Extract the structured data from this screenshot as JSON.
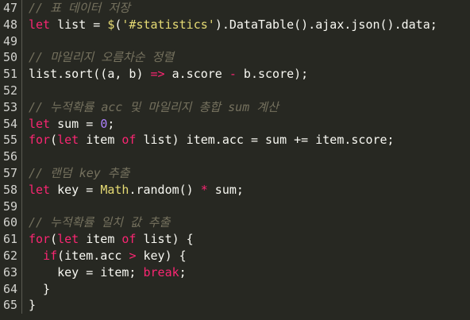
{
  "editor": {
    "lines": [
      {
        "number": "47",
        "tokens": [
          {
            "type": "comment",
            "text": "// 표 데이터 저장"
          }
        ]
      },
      {
        "number": "48",
        "tokens": [
          {
            "type": "keyword",
            "text": "let"
          },
          {
            "type": "plain",
            "text": " list = "
          },
          {
            "type": "func",
            "text": "$"
          },
          {
            "type": "plain",
            "text": "("
          },
          {
            "type": "string",
            "text": "'#statistics'"
          },
          {
            "type": "plain",
            "text": ").DataTable().ajax.json().data;"
          }
        ]
      },
      {
        "number": "49",
        "tokens": []
      },
      {
        "number": "50",
        "tokens": [
          {
            "type": "comment",
            "text": "// 마일리지 오름차순 정렬"
          }
        ]
      },
      {
        "number": "51",
        "tokens": [
          {
            "type": "plain",
            "text": "list.sort((a, b) "
          },
          {
            "type": "keyword",
            "text": "=>"
          },
          {
            "type": "plain",
            "text": " a.score "
          },
          {
            "type": "keyword",
            "text": "-"
          },
          {
            "type": "plain",
            "text": " b.score);"
          }
        ]
      },
      {
        "number": "52",
        "tokens": []
      },
      {
        "number": "53",
        "tokens": [
          {
            "type": "comment",
            "text": "// 누적확률 acc 및 마일리지 총합 sum 계산"
          }
        ]
      },
      {
        "number": "54",
        "tokens": [
          {
            "type": "keyword",
            "text": "let"
          },
          {
            "type": "plain",
            "text": " sum = "
          },
          {
            "type": "number",
            "text": "0"
          },
          {
            "type": "plain",
            "text": ";"
          }
        ]
      },
      {
        "number": "55",
        "tokens": [
          {
            "type": "keyword",
            "text": "for"
          },
          {
            "type": "plain",
            "text": "("
          },
          {
            "type": "keyword",
            "text": "let"
          },
          {
            "type": "plain",
            "text": " item "
          },
          {
            "type": "keyword",
            "text": "of"
          },
          {
            "type": "plain",
            "text": " list) item.acc = sum += item.score;"
          }
        ]
      },
      {
        "number": "56",
        "tokens": []
      },
      {
        "number": "57",
        "tokens": [
          {
            "type": "comment",
            "text": "// 랜덤 key 추출"
          }
        ]
      },
      {
        "number": "58",
        "tokens": [
          {
            "type": "keyword",
            "text": "let"
          },
          {
            "type": "plain",
            "text": " key = "
          },
          {
            "type": "func",
            "text": "Math"
          },
          {
            "type": "plain",
            "text": ".random() "
          },
          {
            "type": "keyword",
            "text": "*"
          },
          {
            "type": "plain",
            "text": " sum;"
          }
        ]
      },
      {
        "number": "59",
        "tokens": []
      },
      {
        "number": "60",
        "tokens": [
          {
            "type": "comment",
            "text": "// 누적확률 일치 값 추출"
          }
        ]
      },
      {
        "number": "61",
        "tokens": [
          {
            "type": "keyword",
            "text": "for"
          },
          {
            "type": "plain",
            "text": "("
          },
          {
            "type": "keyword",
            "text": "let"
          },
          {
            "type": "plain",
            "text": " item "
          },
          {
            "type": "keyword",
            "text": "of"
          },
          {
            "type": "plain",
            "text": " list) {"
          }
        ]
      },
      {
        "number": "62",
        "tokens": [
          {
            "type": "plain",
            "text": "  "
          },
          {
            "type": "keyword",
            "text": "if"
          },
          {
            "type": "plain",
            "text": "(item.acc "
          },
          {
            "type": "keyword",
            "text": ">"
          },
          {
            "type": "plain",
            "text": " key) {"
          }
        ]
      },
      {
        "number": "63",
        "tokens": [
          {
            "type": "plain",
            "text": "    key = item; "
          },
          {
            "type": "keyword",
            "text": "break"
          },
          {
            "type": "plain",
            "text": ";"
          }
        ]
      },
      {
        "number": "64",
        "tokens": [
          {
            "type": "plain",
            "text": "  }"
          }
        ]
      },
      {
        "number": "65",
        "tokens": [
          {
            "type": "plain",
            "text": "}"
          }
        ]
      }
    ]
  },
  "colors": {
    "background": "#272822",
    "gutter_text": "#d3d3cf",
    "keyword": "#f92672",
    "comment": "#75715e",
    "string": "#e6db74",
    "number": "#ae81ff",
    "plain": "#f8f8f2"
  }
}
